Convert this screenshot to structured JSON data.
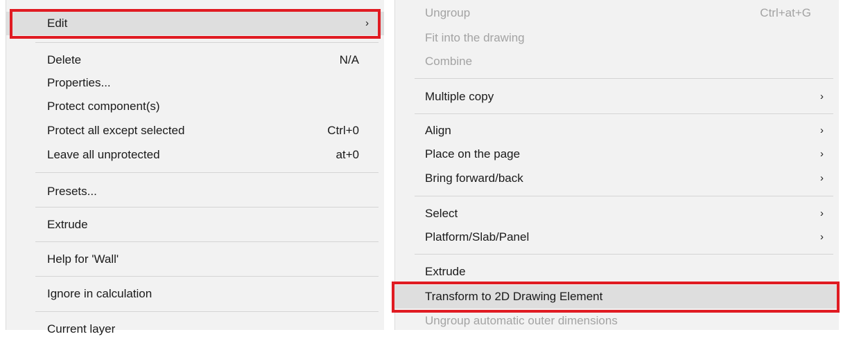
{
  "left_menu": {
    "items": [
      {
        "label": "Edit",
        "shortcut": "",
        "submenu_glyph": "›"
      },
      {
        "label": "Delete",
        "shortcut": "N/A"
      },
      {
        "label": "Properties...",
        "shortcut": ""
      },
      {
        "label": "Protect component(s)",
        "shortcut": ""
      },
      {
        "label": "Protect all except selected",
        "shortcut": "Ctrl+0"
      },
      {
        "label": "Leave all unprotected",
        "shortcut": "at+0"
      },
      {
        "label": "Presets...",
        "shortcut": ""
      },
      {
        "label": "Extrude",
        "shortcut": ""
      },
      {
        "label": "Help for 'Wall'",
        "shortcut": ""
      },
      {
        "label": "Ignore in calculation",
        "shortcut": ""
      },
      {
        "label": "Current layer",
        "shortcut": ""
      }
    ]
  },
  "right_menu": {
    "items": [
      {
        "label": "Ungroup",
        "shortcut": "Ctrl+at+G",
        "disabled": true
      },
      {
        "label": "Fit into the drawing",
        "disabled": true
      },
      {
        "label": "Combine",
        "disabled": true
      },
      {
        "label": "Multiple copy",
        "submenu_glyph": "›"
      },
      {
        "label": "Align",
        "submenu_glyph": "›"
      },
      {
        "label": "Place on the page",
        "submenu_glyph": "›"
      },
      {
        "label": "Bring forward/back",
        "submenu_glyph": "›"
      },
      {
        "label": "Select",
        "submenu_glyph": "›"
      },
      {
        "label": "Platform/Slab/Panel",
        "submenu_glyph": "›"
      },
      {
        "label": "Extrude"
      },
      {
        "label": "Transform to 2D Drawing Element"
      },
      {
        "label": "Ungroup automatic outer dimensions",
        "disabled": true
      }
    ]
  },
  "colors": {
    "highlight_box": "#e01b22",
    "menu_bg": "#f2f2f2",
    "disabled_text": "#a3a3a3"
  }
}
